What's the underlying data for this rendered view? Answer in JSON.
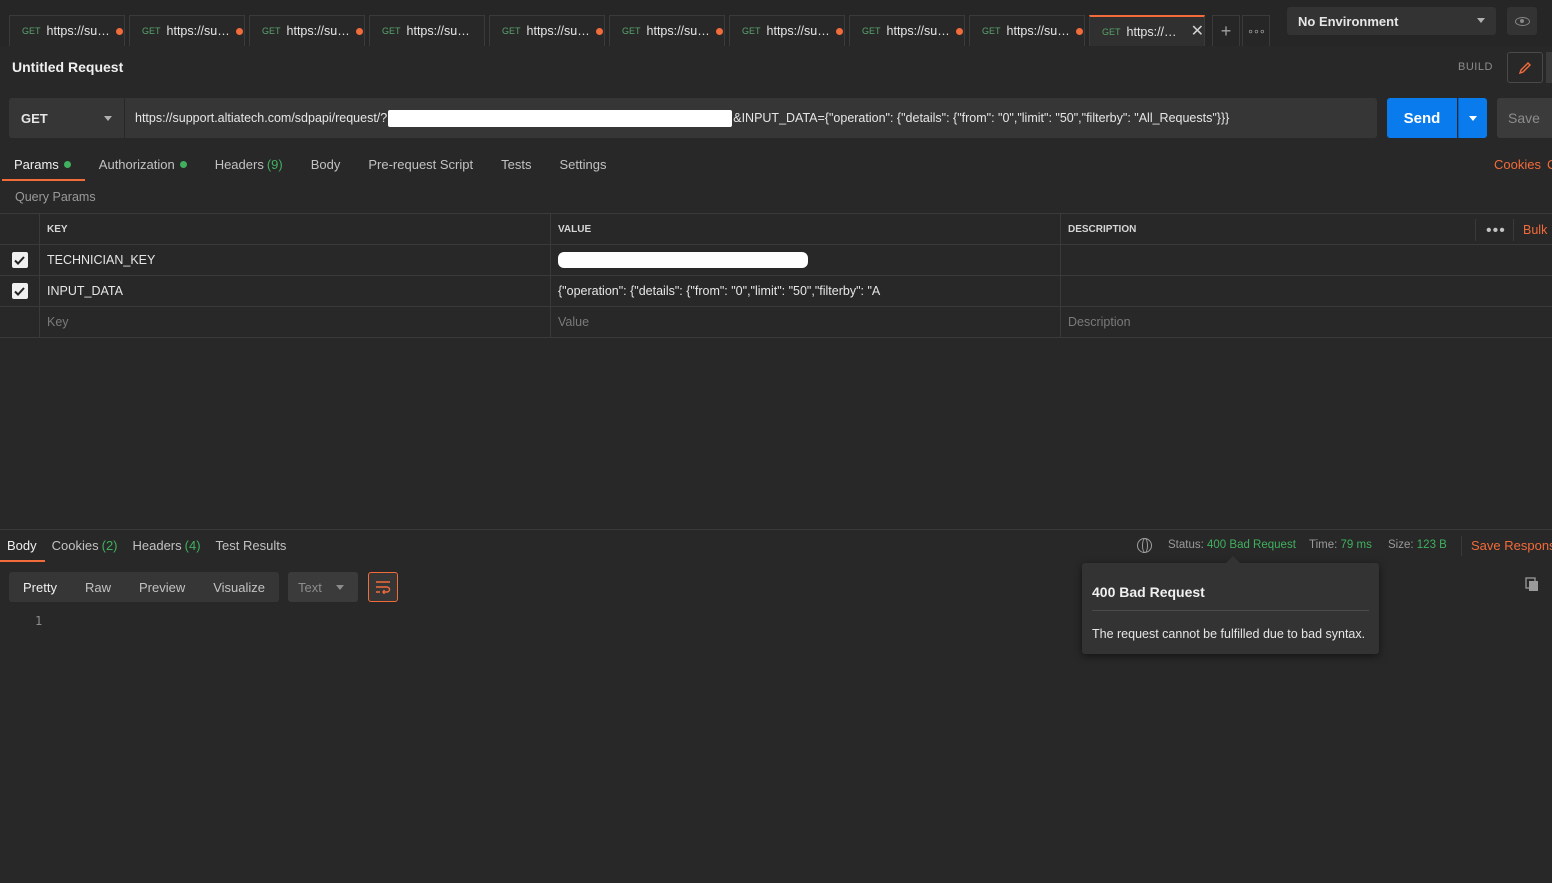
{
  "tabs": [
    {
      "method": "GET",
      "url": "https://support.altiatech.com/sdpapi/request/",
      "unsaved": true,
      "active": false
    },
    {
      "method": "GET",
      "url": "https://support.altiatech.com/sdpapi/request/",
      "unsaved": true,
      "active": false
    },
    {
      "method": "GET",
      "url": "https://support.altiatech.com/sdpapi/request/",
      "unsaved": true,
      "active": false
    },
    {
      "method": "GET",
      "url": "https://support.altiatech.com/sdpapi/request/",
      "unsaved": false,
      "active": false
    },
    {
      "method": "GET",
      "url": "https://support.altiatech.com/sdpapi/request/",
      "unsaved": true,
      "active": false
    },
    {
      "method": "GET",
      "url": "https://support.altiatech.com/sdpapi/request/",
      "unsaved": true,
      "active": false
    },
    {
      "method": "GET",
      "url": "https://support.altiatech.com/sdpapi/request/",
      "unsaved": true,
      "active": false
    },
    {
      "method": "GET",
      "url": "https://support.altiatech.com/sdpapi/request/",
      "unsaved": true,
      "active": false
    },
    {
      "method": "GET",
      "url": "https://support.altiatech.com/sdpapi/request/",
      "unsaved": true,
      "active": false
    },
    {
      "method": "GET",
      "url": "https://support.altiatech.com/sdpapi/request/",
      "unsaved": false,
      "active": true
    }
  ],
  "tab_actions": {
    "new_tab": "+",
    "more": "∘∘∘"
  },
  "environment": {
    "selected": "No Environment"
  },
  "request": {
    "title": "Untitled Request",
    "mode": "BUILD",
    "method": "GET",
    "url_prefix": "https://support.altiatech.com/sdpapi/request/?",
    "url_suffix": "&INPUT_DATA={\"operation\": {\"details\": {\"from\": \"0\",\"limit\": \"50\",\"filterby\": \"All_Requests\"}}}",
    "send_label": "Send",
    "save_label": "Save"
  },
  "request_tabs": {
    "params": "Params",
    "authorization": "Authorization",
    "headers": "Headers",
    "headers_count": "(9)",
    "body": "Body",
    "pre_request": "Pre-request Script",
    "tests": "Tests",
    "settings": "Settings",
    "cookies": "Cookies",
    "cookies_clipped": "C"
  },
  "params": {
    "section_label": "Query Params",
    "columns": {
      "key": "KEY",
      "value": "VALUE",
      "description": "DESCRIPTION",
      "bulk": "Bulk"
    },
    "rows": [
      {
        "checked": true,
        "key": "TECHNICIAN_KEY",
        "value": "",
        "redacted": true,
        "description": ""
      },
      {
        "checked": true,
        "key": "INPUT_DATA",
        "value": "{\"operation\": {\"details\": {\"from\": \"0\",\"limit\": \"50\",\"filterby\": \"A",
        "redacted": false,
        "description": ""
      }
    ],
    "placeholders": {
      "key": "Key",
      "value": "Value",
      "description": "Description"
    }
  },
  "response": {
    "tabs": {
      "body": "Body",
      "cookies": "Cookies",
      "cookies_count": "(2)",
      "headers": "Headers",
      "headers_count": "(4)",
      "tests": "Test Results"
    },
    "status_label": "Status:",
    "status_value": "400 Bad Request",
    "time_label": "Time:",
    "time_value": "79 ms",
    "size_label": "Size:",
    "size_value": "123 B",
    "save_response": "Save Response",
    "views": [
      "Pretty",
      "Raw",
      "Preview",
      "Visualize"
    ],
    "active_view": "Pretty",
    "format": "Text",
    "line_number": "1"
  },
  "tooltip": {
    "title": "400 Bad Request",
    "body": "The request cannot be fulfilled due to bad syntax."
  },
  "colors": {
    "accent": "#f26b3a",
    "method_get": "#59a36b",
    "status_ok": "#40b05e",
    "send": "#097bed",
    "background": "#282828"
  }
}
